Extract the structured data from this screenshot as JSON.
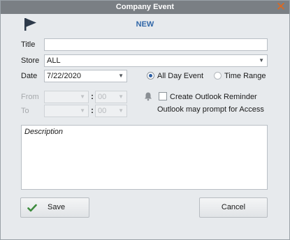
{
  "window": {
    "title": "Company Event",
    "close_glyph": "✕"
  },
  "header": {
    "status": "NEW",
    "icon": "flag-icon"
  },
  "form": {
    "title_label": "Title",
    "title_value": "",
    "store_label": "Store",
    "store_value": "ALL",
    "date_label": "Date",
    "date_value": "7/22/2020",
    "all_day_label": "All Day Event",
    "all_day_selected": true,
    "time_range_label": "Time Range",
    "from_label": "From",
    "to_label": "To",
    "from_hour": "",
    "from_minute": "00",
    "to_hour": "",
    "to_minute": "00",
    "time_separator": ":",
    "reminder_label": "Create Outlook Reminder",
    "reminder_checked": false,
    "reminder_note": "Outlook may prompt for Access",
    "reminder_icon": "bell-icon",
    "description_placeholder": "Description"
  },
  "buttons": {
    "save_label": "Save",
    "cancel_label": "Cancel",
    "save_icon": "checkmark-icon"
  },
  "colors": {
    "accent": "#3167a8",
    "titlebar": "#7a7f84",
    "close": "#e0681c",
    "save_check": "#3d8b3d",
    "background": "#e7eaed"
  }
}
